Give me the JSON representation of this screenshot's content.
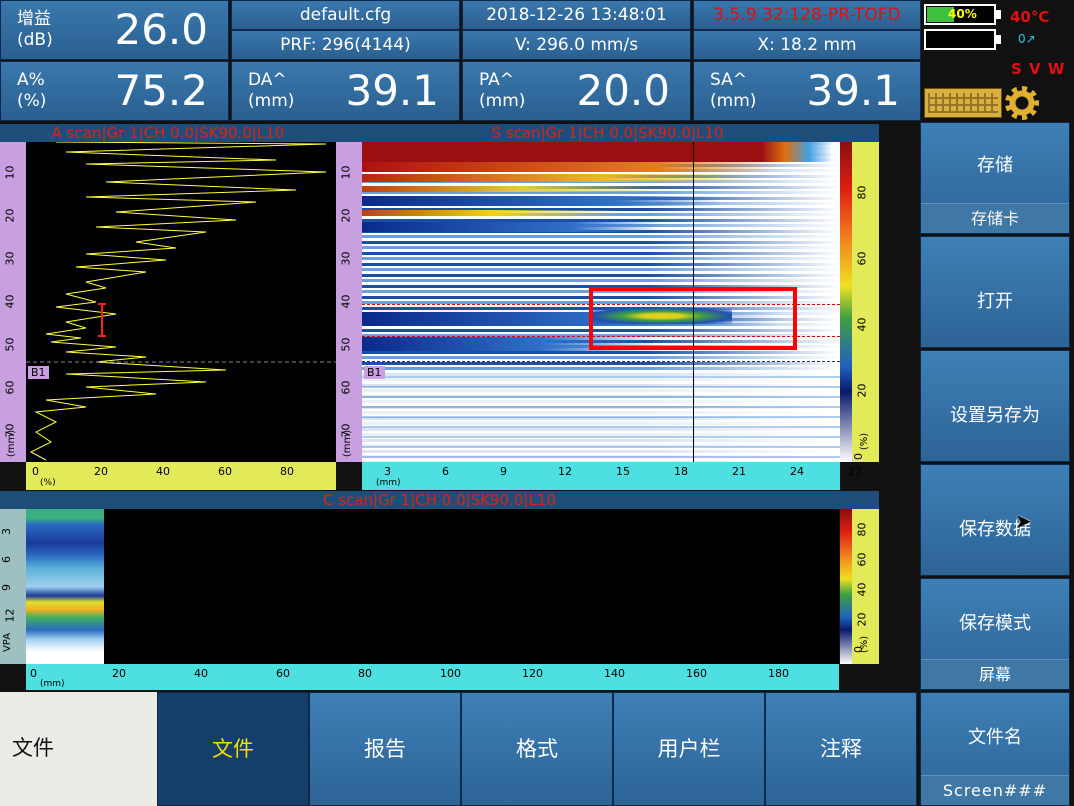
{
  "header": {
    "gain_label_1": "增益",
    "gain_label_2": "(dB)",
    "gain_value": "26.0",
    "amp_label_1": "A%",
    "amp_label_2": "(%)",
    "amp_value": "75.2",
    "config_file": "default.cfg",
    "prf": "PRF: 296(4144)",
    "datetime": "2018-12-26 13:48:01",
    "velocity": "V: 296.0 mm/s",
    "probe": "3.5.9  32:128-PR-TOFD",
    "x_pos": "X: 18.2 mm",
    "da_label_1": "DA^",
    "da_label_2": "(mm)",
    "da_value": "39.1",
    "pa_label_1": "PA^",
    "pa_label_2": "(mm)",
    "pa_value": "20.0",
    "sa_label_1": "SA^",
    "sa_label_2": "(mm)",
    "sa_value": "39.1"
  },
  "status": {
    "battery_percent": "40%",
    "battery_level": 0.4,
    "temperature": "40°C",
    "indicator": "0",
    "letters": "S V W",
    "keyboard_icon": "keyboard-icon",
    "settings_icon": "gear-icon"
  },
  "a_scan": {
    "title": "A scan|Gr 1|CH 0.0|SK90.0|L10",
    "v_ticks": [
      "10",
      "20",
      "30",
      "40",
      "50",
      "60",
      "70"
    ],
    "v_unit": "(mm)",
    "h_ticks": [
      "0",
      "20",
      "40",
      "60",
      "80"
    ],
    "h_unit": "(%)",
    "gate_label": "B1"
  },
  "s_scan": {
    "title": "S scan|Gr 1|CH 0.0|SK90.0|L10",
    "v_ticks": [
      "10",
      "20",
      "30",
      "40",
      "50",
      "60",
      "70"
    ],
    "v_unit": "(mm)",
    "h_ticks": [
      "3",
      "6",
      "9",
      "12",
      "15",
      "18",
      "21",
      "24",
      "27"
    ],
    "h_unit": "(mm)",
    "gate_label": "B1",
    "palette_ticks": [
      "80",
      "60",
      "40",
      "20",
      "0"
    ],
    "palette_unit": "(%)"
  },
  "c_scan": {
    "title": "C scan|Gr 1|CH 0.0|SK90.0|L10",
    "v_ticks": [
      "3",
      "6",
      "9",
      "12"
    ],
    "v_unit": "VPA",
    "h_ticks": [
      "0",
      "20",
      "40",
      "60",
      "80",
      "100",
      "120",
      "140",
      "160",
      "180"
    ],
    "h_unit": "(mm)",
    "palette_ticks": [
      "80",
      "60",
      "40",
      "20",
      "0"
    ],
    "palette_unit": "(%)"
  },
  "sidebar": {
    "items": [
      {
        "label": "存储",
        "sub": "存储卡"
      },
      {
        "label": "打开"
      },
      {
        "label": "设置另存为"
      },
      {
        "label": "保存数据"
      },
      {
        "label": "保存模式",
        "sub": "屏幕"
      },
      {
        "label": "文件名",
        "sub": "Screen###"
      }
    ]
  },
  "bottom": {
    "menu_title": "文件",
    "tabs": [
      "文件",
      "报告",
      "格式",
      "用户栏",
      "注释"
    ],
    "active_tab": 0
  },
  "colors": {
    "header_blue": "#2e68a0",
    "alert_red": "#e01010",
    "active_tab_text": "#f0e000"
  }
}
